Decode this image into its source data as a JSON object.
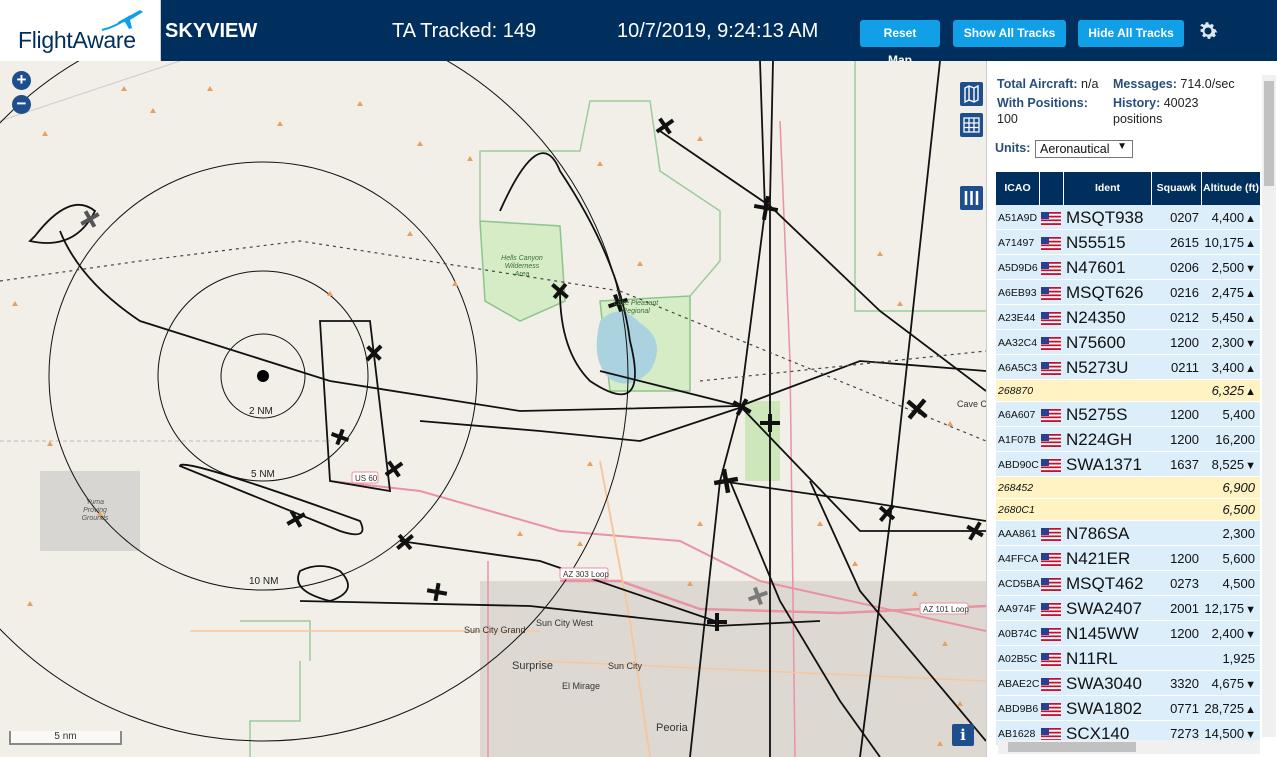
{
  "header": {
    "logo_text": "FlightAware",
    "app_title": "SKYVIEW",
    "tracked": "TA Tracked: 149",
    "clock": "10/7/2019, 9:24:13 AM",
    "reset_label": "Reset Map",
    "show_label": "Show All Tracks",
    "hide_label": "Hide All Tracks",
    "settings_icon": "gear-icon"
  },
  "map": {
    "zoom_in": "+",
    "zoom_out": "−",
    "ring_labels": [
      "2 NM",
      "5 NM",
      "10 NM"
    ],
    "scale_label": "5 nm",
    "info_label": "i",
    "place_labels": {
      "hells_canyon": [
        "Hells Canyon",
        "Wilderness",
        "Area"
      ],
      "lake_pleasant": [
        "Lake Pleasant",
        "Regional"
      ],
      "yuma_proving": [
        "Yuma",
        "Proving",
        "Grounds"
      ],
      "sun_city_grand": "Sun City Grand",
      "sun_city_west": "Sun City West",
      "surprise": "Surprise",
      "sun_city": "Sun City",
      "el_mirage": "El Mirage",
      "peoria": "Peoria",
      "cave_creek": "Cave Cr",
      "us60": "US 60",
      "az303": "AZ 303 Loop",
      "az101": "AZ 101 Loop"
    },
    "controls": [
      "map-icon",
      "grid-icon",
      "columns-icon"
    ],
    "colors": {
      "land": "#f2efe9",
      "water": "#aad3df",
      "park": "#c8e6b5",
      "boundary": "#8cc48c",
      "track": "#000000",
      "road": "#e892a2"
    }
  },
  "panel": {
    "total_label": "Total Aircraft:",
    "total_value": "n/a",
    "messages_label": "Messages:",
    "messages_value": "714.0/sec",
    "positions_label": "With Positions:",
    "positions_value": "100",
    "history_label": "History:",
    "history_value": "40023",
    "history_unit": "positions",
    "units_label": "Units:",
    "units_value": "Aeronautical",
    "columns": [
      "ICAO",
      "",
      "Ident",
      "Squawk",
      "Altitude (ft)"
    ],
    "rows": [
      {
        "icao": "A51A9D",
        "flag": true,
        "ident": "MSQT938",
        "squawk": "0207",
        "alt": "4,400",
        "trend": "▲",
        "hl": false
      },
      {
        "icao": "A71497",
        "flag": true,
        "ident": "N55515",
        "squawk": "2615",
        "alt": "10,175",
        "trend": "▲",
        "hl": false
      },
      {
        "icao": "A5D9D6",
        "flag": true,
        "ident": "N47601",
        "squawk": "0206",
        "alt": "2,500",
        "trend": "▼",
        "hl": false
      },
      {
        "icao": "A6EB93",
        "flag": true,
        "ident": "MSQT626",
        "squawk": "0216",
        "alt": "2,475",
        "trend": "▲",
        "hl": false
      },
      {
        "icao": "A23E44",
        "flag": true,
        "ident": "N24350",
        "squawk": "0212",
        "alt": "5,450",
        "trend": "▲",
        "hl": false
      },
      {
        "icao": "AA32C4",
        "flag": true,
        "ident": "N75600",
        "squawk": "1200",
        "alt": "2,300",
        "trend": "▼",
        "hl": false
      },
      {
        "icao": "A6A5C3",
        "flag": true,
        "ident": "N5273U",
        "squawk": "0211",
        "alt": "3,400",
        "trend": "▲",
        "hl": false
      },
      {
        "icao": "268870",
        "flag": false,
        "ident": "",
        "squawk": "",
        "alt": "6,325",
        "trend": "▲",
        "hl": true
      },
      {
        "icao": "A6A607",
        "flag": true,
        "ident": "N5275S",
        "squawk": "1200",
        "alt": "5,400",
        "trend": "",
        "hl": false
      },
      {
        "icao": "A1F07B",
        "flag": true,
        "ident": "N224GH",
        "squawk": "1200",
        "alt": "16,200",
        "trend": "",
        "hl": false
      },
      {
        "icao": "ABD90C",
        "flag": true,
        "ident": "SWA1371",
        "squawk": "1637",
        "alt": "8,525",
        "trend": "▼",
        "hl": false
      },
      {
        "icao": "268452",
        "flag": false,
        "ident": "",
        "squawk": "",
        "alt": "6,900",
        "trend": "",
        "hl": true
      },
      {
        "icao": "2680C1",
        "flag": false,
        "ident": "",
        "squawk": "",
        "alt": "6,500",
        "trend": "",
        "hl": true
      },
      {
        "icao": "AAA861",
        "flag": true,
        "ident": "N786SA",
        "squawk": "",
        "alt": "2,300",
        "trend": "",
        "hl": false
      },
      {
        "icao": "A4FFCA",
        "flag": true,
        "ident": "N421ER",
        "squawk": "1200",
        "alt": "5,600",
        "trend": "",
        "hl": false
      },
      {
        "icao": "ACD5BA",
        "flag": true,
        "ident": "MSQT462",
        "squawk": "0273",
        "alt": "4,500",
        "trend": "",
        "hl": false
      },
      {
        "icao": "AA974F",
        "flag": true,
        "ident": "SWA2407",
        "squawk": "2001",
        "alt": "12,175",
        "trend": "▼",
        "hl": false
      },
      {
        "icao": "A0B74C",
        "flag": true,
        "ident": "N145WW",
        "squawk": "1200",
        "alt": "2,400",
        "trend": "▼",
        "hl": false
      },
      {
        "icao": "A02B5C",
        "flag": true,
        "ident": "N11RL",
        "squawk": "",
        "alt": "1,925",
        "trend": "",
        "hl": false
      },
      {
        "icao": "ABAE2C",
        "flag": true,
        "ident": "SWA3040",
        "squawk": "3320",
        "alt": "4,675",
        "trend": "▼",
        "hl": false
      },
      {
        "icao": "ABD9B6",
        "flag": true,
        "ident": "SWA1802",
        "squawk": "0771",
        "alt": "28,725",
        "trend": "▲",
        "hl": false
      },
      {
        "icao": "AB1628",
        "flag": true,
        "ident": "SCX140",
        "squawk": "7273",
        "alt": "14,500",
        "trend": "▼",
        "hl": false
      }
    ]
  }
}
